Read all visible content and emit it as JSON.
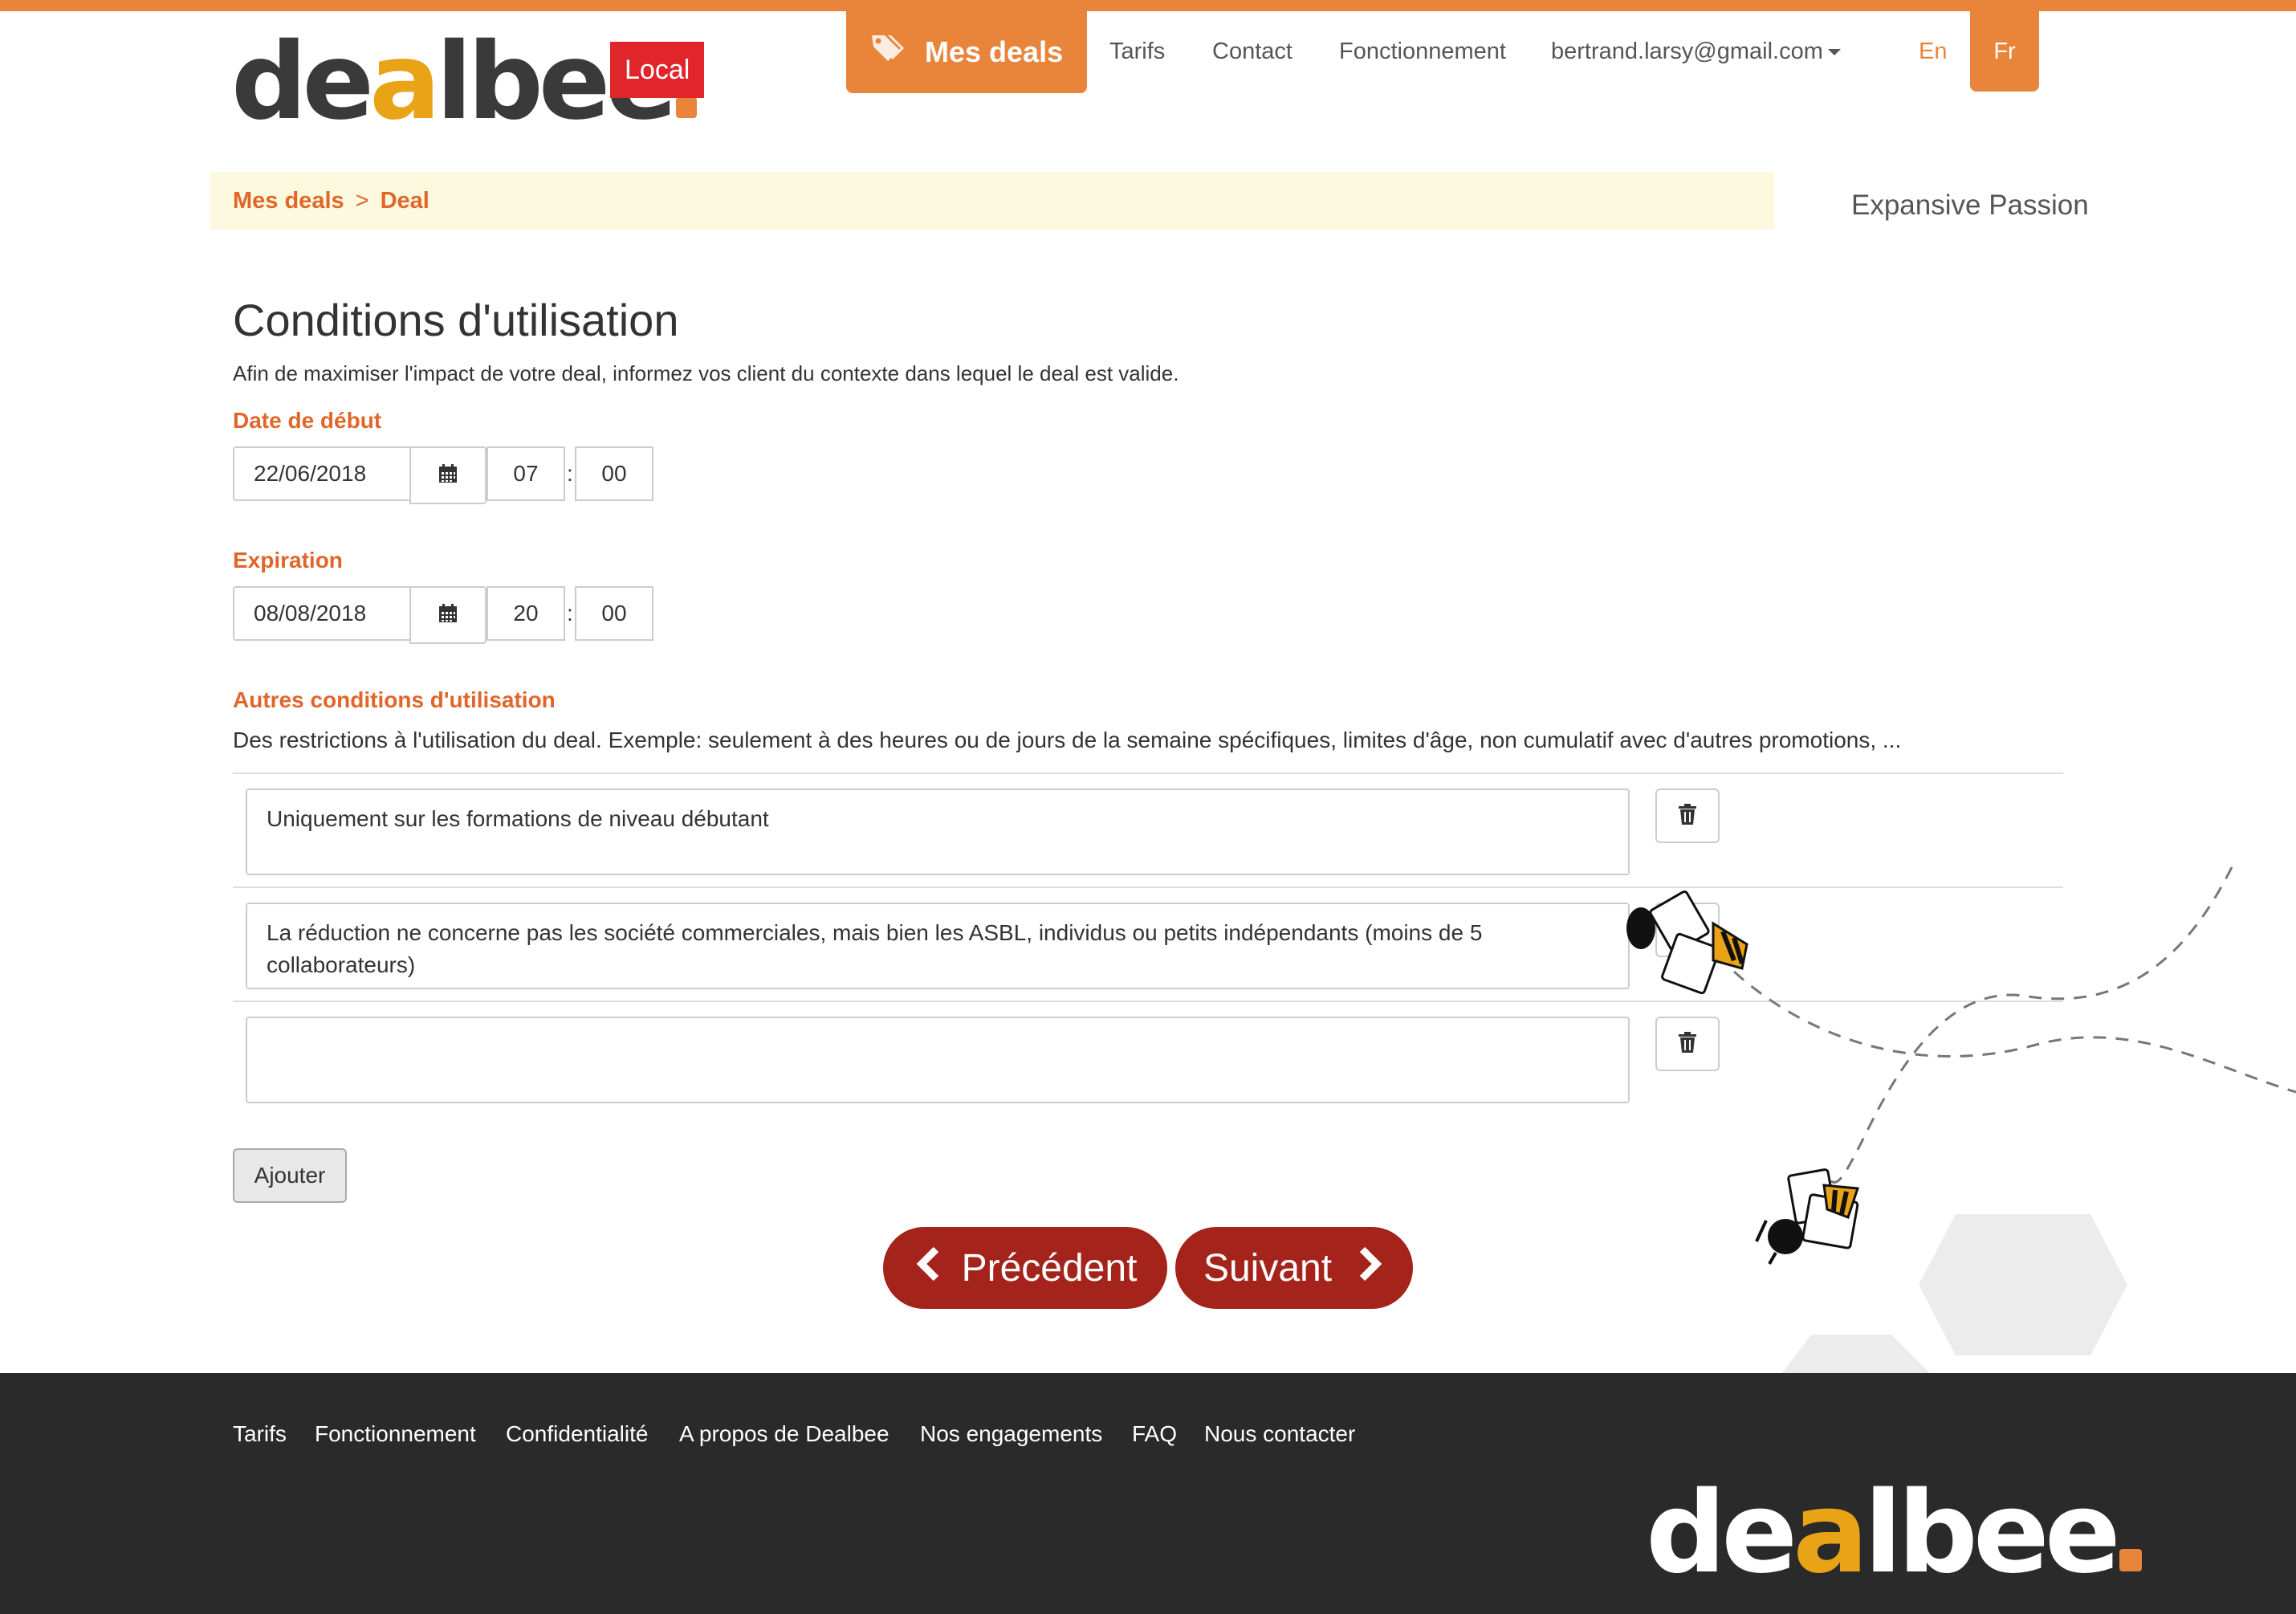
{
  "brand": {
    "logo_parts": [
      "de",
      "a",
      "lbee"
    ],
    "badge": "Local",
    "accent_color": "#e8853b",
    "badge_color": "#e0262a",
    "button_color": "#a4231b"
  },
  "nav": {
    "active_label": "Mes deals",
    "active_icon": "tags-icon",
    "links": [
      "Tarifs",
      "Contact",
      "Fonctionnement"
    ],
    "user_email": "bertrand.larsy@gmail.com",
    "lang_en": "En",
    "lang_fr": "Fr"
  },
  "breadcrumb": {
    "items": [
      "Mes deals",
      "Deal"
    ],
    "separator": ">"
  },
  "business_name": "Expansive Passion",
  "main": {
    "title": "Conditions d'utilisation",
    "intro": "Afin de maximiser l'impact de votre deal, informez vos client du contexte dans lequel le deal est valide.",
    "start": {
      "label": "Date de début",
      "date": "22/06/2018",
      "hour": "07",
      "minute": "00",
      "separator": ":"
    },
    "expiration": {
      "label": "Expiration",
      "date": "08/08/2018",
      "hour": "20",
      "minute": "00",
      "separator": ":"
    },
    "other_conditions": {
      "label": "Autres conditions d'utilisation",
      "description": "Des restrictions à l'utilisation du deal. Exemple: seulement à des heures ou de jours de la semaine spécifiques, limites d'âge, non cumulatif avec d'autres promotions, ...",
      "items": [
        "Uniquement sur les formations de niveau débutant",
        " La réduction ne concerne pas les société commerciales, mais bien les ASBL, individus ou petits indépendants (moins de 5 collaborateurs)",
        ""
      ]
    },
    "add_label": "Ajouter",
    "prev_label": "Précédent",
    "next_label": "Suivant"
  },
  "footer": {
    "links": [
      "Tarifs",
      "Fonctionnement",
      "Confidentialité",
      "A propos de Dealbee",
      "Nos engagements",
      "FAQ",
      "Nous contacter"
    ],
    "logo_parts": [
      "de",
      "a",
      "lbee"
    ]
  }
}
